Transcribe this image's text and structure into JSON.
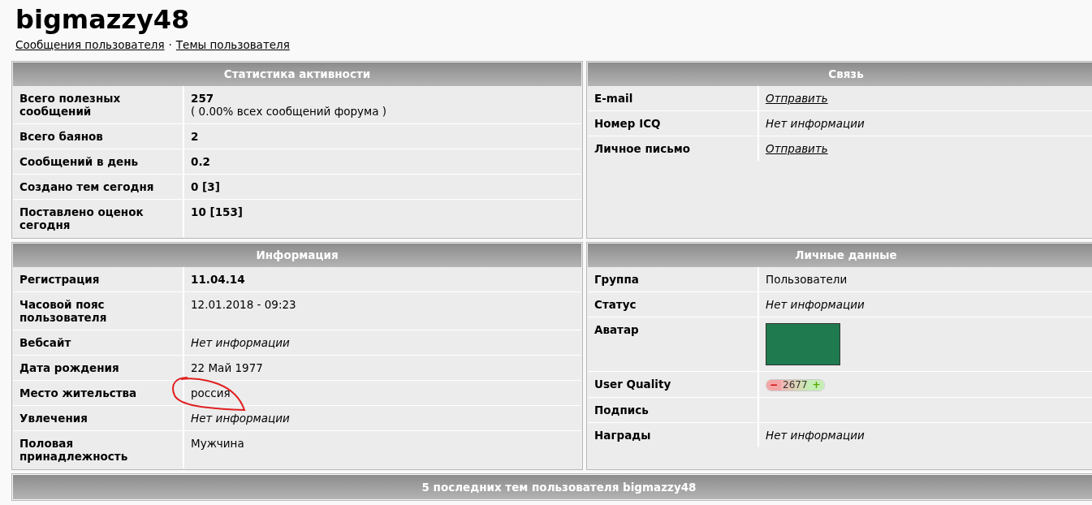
{
  "title": "bigmazzy48",
  "links": [
    "Сообщения пользователя",
    "Темы пользователя"
  ],
  "link_separator": "·",
  "panels": [
    {
      "heading": "Статистика активности",
      "rows": [
        {
          "label": "Всего полезных сообщений",
          "kind": "bold_note",
          "value": "257",
          "note": "( 0.00% всех сообщений форума )"
        },
        {
          "label": "Всего баянов",
          "kind": "bold",
          "value": "2"
        },
        {
          "label": "Сообщений в день",
          "kind": "bold",
          "value": "0.2"
        },
        {
          "label": "Создано тем сегодня",
          "kind": "bold",
          "value": "0 [3]"
        },
        {
          "label": "Поставлено оценок сегодня",
          "kind": "bold",
          "value": "10 [153]"
        }
      ]
    },
    {
      "heading": "Связь",
      "rows": [
        {
          "label": "E-mail",
          "kind": "link",
          "value": "Отправить"
        },
        {
          "label": "Номер ICQ",
          "kind": "italic",
          "value": "Нет информации"
        },
        {
          "label": "Личное письмо",
          "kind": "link",
          "value": "Отправить"
        }
      ]
    },
    {
      "heading": "Информация",
      "rows": [
        {
          "label": "Регистрация",
          "kind": "bold",
          "value": "11.04.14"
        },
        {
          "label": "Часовой пояс пользователя",
          "kind": "plain",
          "value": "12.01.2018 - 09:23"
        },
        {
          "label": "Вебсайт",
          "kind": "italic",
          "value": "Нет информации"
        },
        {
          "label": "Дата рождения",
          "kind": "plain",
          "value": "22 Май 1977"
        },
        {
          "label": "Место жительства",
          "kind": "plain",
          "value": "россия",
          "circled": true
        },
        {
          "label": "Увлечения",
          "kind": "italic",
          "value": "Нет информации"
        },
        {
          "label": "Половая принадлежность",
          "kind": "plain",
          "value": "Мужчина"
        }
      ]
    },
    {
      "heading": "Личные данные",
      "rows": [
        {
          "label": "Группа",
          "kind": "plain",
          "value": "Пользователи"
        },
        {
          "label": "Статус",
          "kind": "italic",
          "value": "Нет информации"
        },
        {
          "label": "Аватар",
          "kind": "avatar"
        },
        {
          "label": "User Quality",
          "kind": "quality",
          "minus": "−",
          "value": "2677",
          "plus": "+"
        },
        {
          "label": "Подпись",
          "kind": "empty"
        },
        {
          "label": "Награды",
          "kind": "italic",
          "value": "Нет информации"
        }
      ]
    }
  ],
  "bottom_heading": "5 последних тем пользователя bigmazzy48"
}
